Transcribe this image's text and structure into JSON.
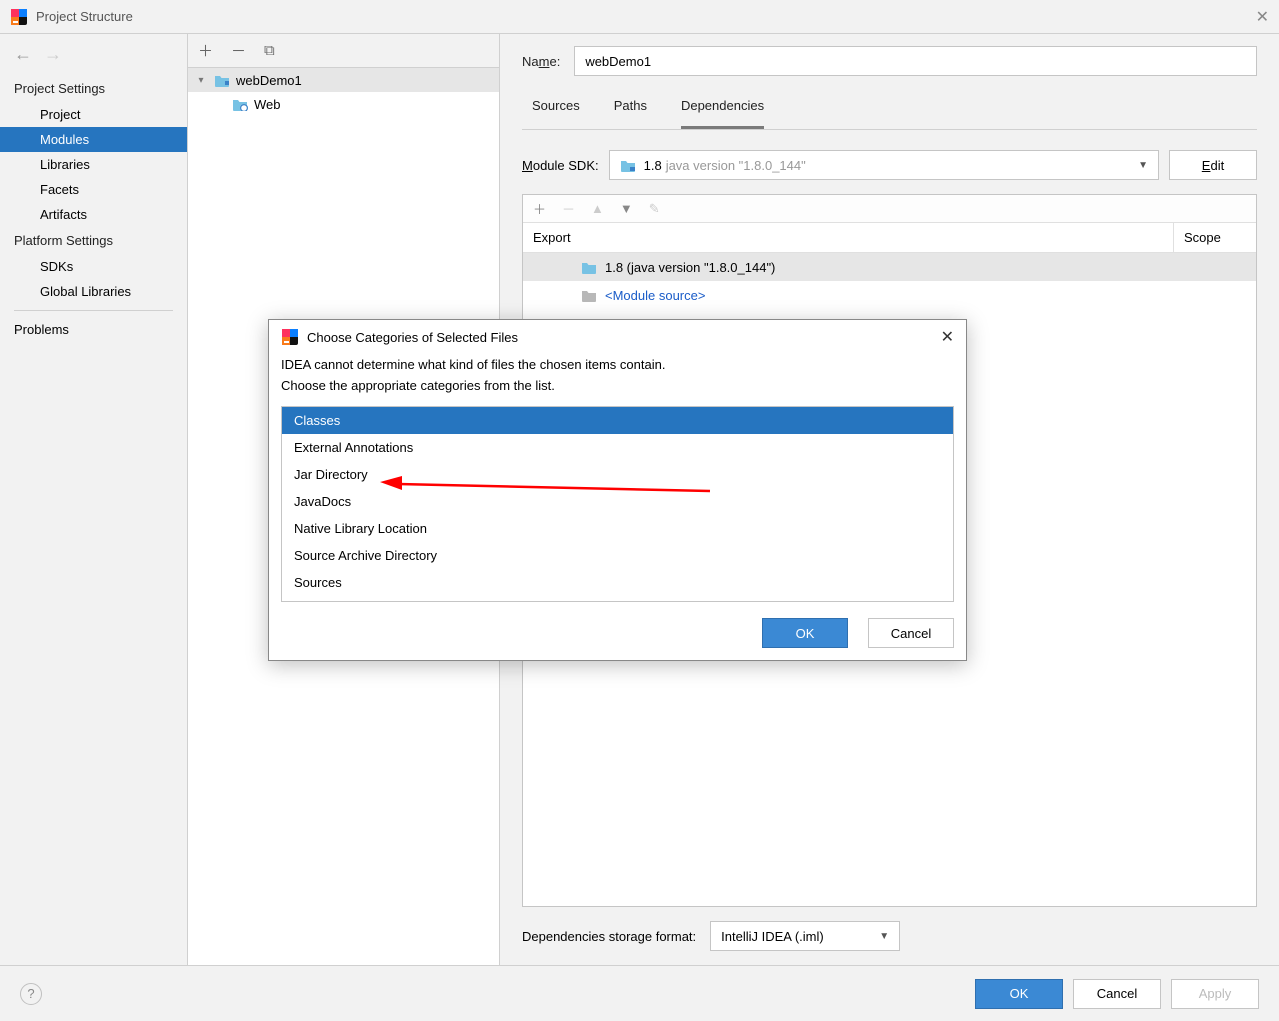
{
  "window": {
    "title": "Project Structure"
  },
  "leftnav": {
    "section1": "Project Settings",
    "items1": [
      "Project",
      "Modules",
      "Libraries",
      "Facets",
      "Artifacts"
    ],
    "selected": "Modules",
    "section2": "Platform Settings",
    "items2": [
      "SDKs",
      "Global Libraries"
    ],
    "problems": "Problems"
  },
  "tree": {
    "root": "webDemo1",
    "child": "Web"
  },
  "detail": {
    "name_label": "Name:",
    "name_value": "webDemo1",
    "tabs": [
      "Sources",
      "Paths",
      "Dependencies"
    ],
    "active_tab": "Dependencies",
    "sdk_label": "Module SDK:",
    "sdk_name": "1.8",
    "sdk_version": "java version \"1.8.0_144\"",
    "edit": "Edit",
    "dep_header_export": "Export",
    "dep_header_scope": "Scope",
    "dep_rows": [
      {
        "label": "1.8 (java version \"1.8.0_144\")",
        "link": false
      },
      {
        "label": "<Module source>",
        "link": true
      }
    ],
    "storage_label": "Dependencies storage format:",
    "storage_value": "IntelliJ IDEA (.iml)"
  },
  "footer": {
    "ok": "OK",
    "cancel": "Cancel",
    "apply": "Apply"
  },
  "modal": {
    "title": "Choose Categories of Selected Files",
    "line1": "IDEA cannot determine what kind of files the chosen items contain.",
    "line2": "Choose the appropriate categories from the list.",
    "categories": [
      "Classes",
      "External Annotations",
      "Jar Directory",
      "JavaDocs",
      "Native Library Location",
      "Source Archive Directory",
      "Sources"
    ],
    "selected": "Classes",
    "ok": "OK",
    "cancel": "Cancel"
  }
}
